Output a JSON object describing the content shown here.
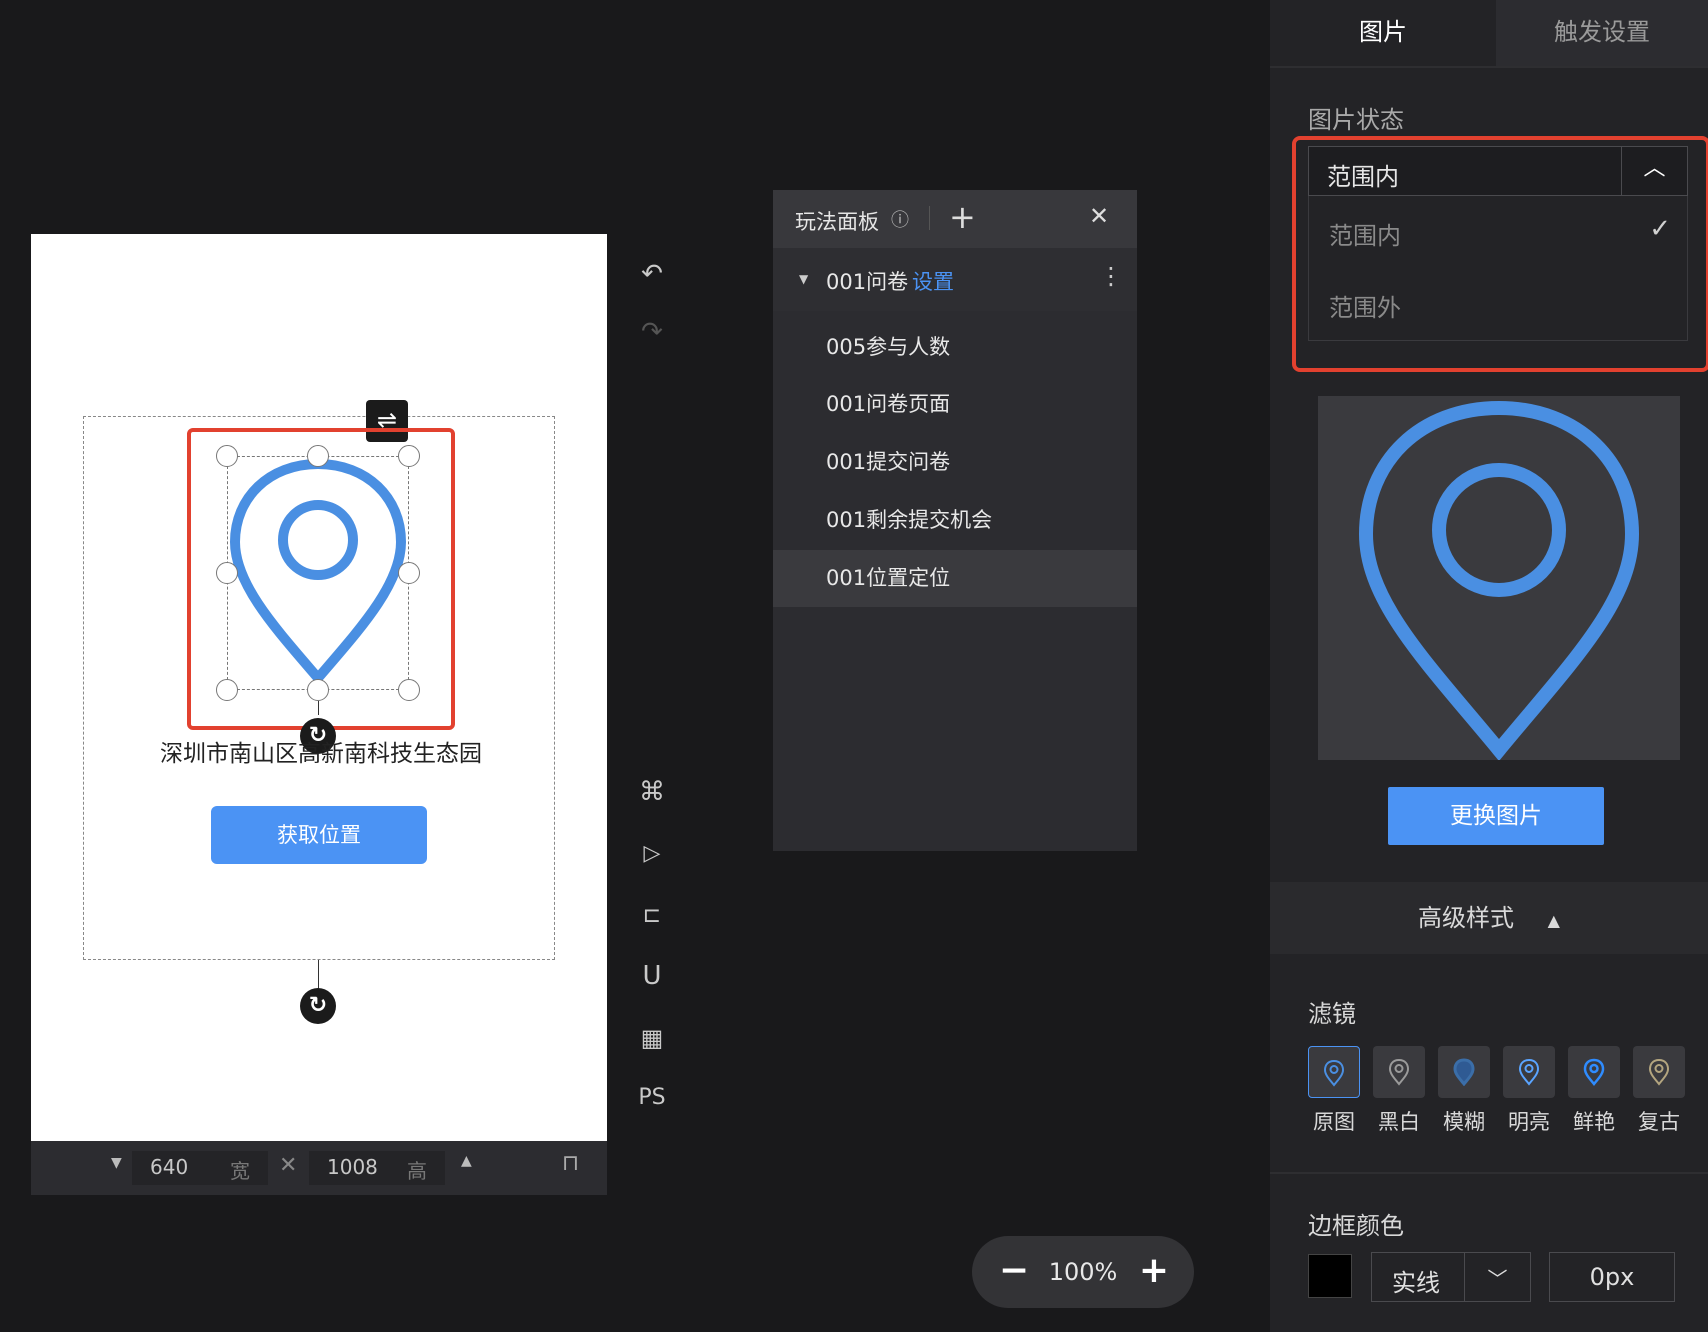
{
  "canvas": {
    "address_text": "深圳市南山区高新南科技生态园",
    "get_location_label": "获取位置",
    "width_value": "640",
    "width_unit": "宽",
    "height_value": "1008",
    "height_unit": "高"
  },
  "toolbar": {
    "items": [
      "undo-icon",
      "redo-icon",
      "command-icon",
      "play-icon",
      "ruler-icon",
      "magnet-icon",
      "grid-icon",
      "ps-label"
    ],
    "ps_label": "PS"
  },
  "gameplay_panel": {
    "title": "玩法面板",
    "group_name": "001问卷",
    "group_link": "设置",
    "items": [
      "005参与人数",
      "001问卷页面",
      "001提交问卷",
      "001剩余提交机会",
      "001位置定位"
    ],
    "active_item": "001位置定位"
  },
  "zoom": {
    "value": "100%"
  },
  "props": {
    "tabs": [
      "图片",
      "触发设置"
    ],
    "active_tab": "图片",
    "image_state_label": "图片状态",
    "dropdown_selected": "范围内",
    "dropdown_options": [
      "范围内",
      "范围外"
    ],
    "replace_image_label": "更换图片",
    "advanced_style_label": "高级样式",
    "filter_label": "滤镜",
    "filters": [
      "原图",
      "黑白",
      "模糊",
      "明亮",
      "鲜艳",
      "复古"
    ],
    "selected_filter": "原图",
    "border_color_label": "边框颜色",
    "border_style": "实线",
    "border_width": "0px"
  },
  "colors": {
    "accent": "#4b93f4",
    "highlight_red": "#e2412f",
    "pin_blue": "#4a8fe2"
  }
}
